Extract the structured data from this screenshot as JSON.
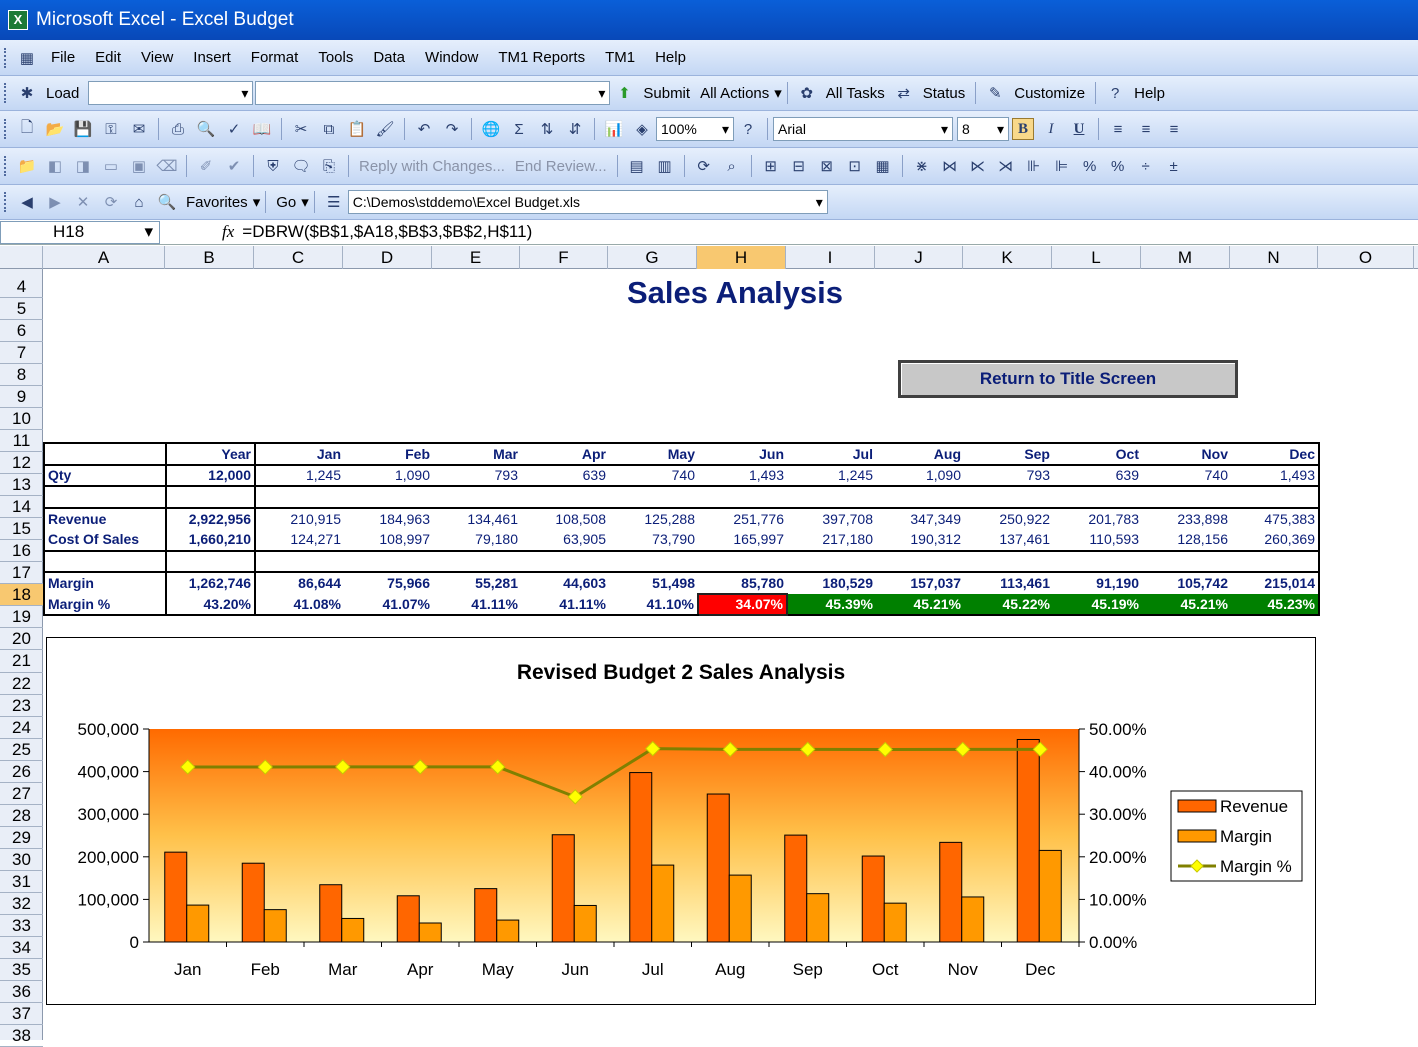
{
  "window": {
    "title": "Microsoft Excel - Excel Budget"
  },
  "menu": [
    "File",
    "Edit",
    "View",
    "Insert",
    "Format",
    "Tools",
    "Data",
    "Window",
    "TM1 Reports",
    "TM1",
    "Help"
  ],
  "tm1bar": {
    "load": "Load",
    "submit": "Submit",
    "all_actions": "All Actions",
    "all_tasks": "All Tasks",
    "status": "Status",
    "customize": "Customize",
    "help": "Help"
  },
  "standard": {
    "zoom": "100%",
    "font": "Arial",
    "size": "8"
  },
  "reviewing": {
    "reply": "Reply with Changes...",
    "end": "End Review..."
  },
  "web": {
    "favorites": "Favorites",
    "go": "Go",
    "address": "C:\\Demos\\stddemo\\Excel Budget.xls"
  },
  "formula": {
    "cell": "H18",
    "fx": "fx",
    "value": "=DBRW($B$1,$A18,$B$3,$B$2,H$11)"
  },
  "columns": [
    "A",
    "B",
    "C",
    "D",
    "E",
    "F",
    "G",
    "H",
    "I",
    "J",
    "K",
    "L",
    "M",
    "N",
    "O"
  ],
  "rows": [
    "4",
    "5",
    "6",
    "7",
    "8",
    "9",
    "10",
    "11",
    "12",
    "13",
    "14",
    "15",
    "16",
    "17",
    "18",
    "19",
    "20",
    "21",
    "22",
    "23",
    "24",
    "25",
    "26",
    "27",
    "28",
    "29",
    "30",
    "31",
    "32",
    "33",
    "34",
    "35",
    "36",
    "37",
    "38"
  ],
  "sheet": {
    "title": "Sales Analysis",
    "return_button": "Return to Title Screen",
    "headers": [
      "Year",
      "Jan",
      "Feb",
      "Mar",
      "Apr",
      "May",
      "Jun",
      "Jul",
      "Aug",
      "Sep",
      "Oct",
      "Nov",
      "Dec"
    ],
    "qty": {
      "label": "Qty",
      "values": [
        "12,000",
        "1,245",
        "1,090",
        "793",
        "639",
        "740",
        "1,493",
        "1,245",
        "1,090",
        "793",
        "639",
        "740",
        "1,493"
      ]
    },
    "revenue": {
      "label": "Revenue",
      "values": [
        "2,922,956",
        "210,915",
        "184,963",
        "134,461",
        "108,508",
        "125,288",
        "251,776",
        "397,708",
        "347,349",
        "250,922",
        "201,783",
        "233,898",
        "475,383"
      ]
    },
    "cost": {
      "label": "Cost Of Sales",
      "values": [
        "1,660,210",
        "124,271",
        "108,997",
        "79,180",
        "63,905",
        "73,790",
        "165,997",
        "217,180",
        "190,312",
        "137,461",
        "110,593",
        "128,156",
        "260,369"
      ]
    },
    "margin": {
      "label": "Margin",
      "values": [
        "1,262,746",
        "86,644",
        "75,966",
        "55,281",
        "44,603",
        "51,498",
        "85,780",
        "180,529",
        "157,037",
        "113,461",
        "91,190",
        "105,742",
        "215,014"
      ]
    },
    "margin_pct": {
      "label": "Margin %",
      "values": [
        "43.20%",
        "41.08%",
        "41.07%",
        "41.11%",
        "41.11%",
        "41.10%",
        "34.07%",
        "45.39%",
        "45.21%",
        "45.22%",
        "45.19%",
        "45.21%",
        "45.23%"
      ]
    }
  },
  "chart_data": {
    "type": "bar",
    "title": "Revised Budget 2 Sales Analysis",
    "categories": [
      "Jan",
      "Feb",
      "Mar",
      "Apr",
      "May",
      "Jun",
      "Jul",
      "Aug",
      "Sep",
      "Oct",
      "Nov",
      "Dec"
    ],
    "series": [
      {
        "name": "Revenue",
        "type": "bar",
        "axis": "left",
        "color": "#ff6600",
        "values": [
          210915,
          184963,
          134461,
          108508,
          125288,
          251776,
          397708,
          347349,
          250922,
          201783,
          233898,
          475383
        ]
      },
      {
        "name": "Margin",
        "type": "bar",
        "axis": "left",
        "color": "#ff9900",
        "values": [
          86644,
          75966,
          55281,
          44603,
          51498,
          85780,
          180529,
          157037,
          113461,
          91190,
          105742,
          215014
        ]
      },
      {
        "name": "Margin %",
        "type": "line",
        "axis": "right",
        "color": "#808000",
        "values": [
          41.08,
          41.07,
          41.11,
          41.11,
          41.1,
          34.07,
          45.39,
          45.21,
          45.22,
          45.19,
          45.21,
          45.23
        ]
      }
    ],
    "ylim": [
      0,
      500000
    ],
    "y2lim": [
      0,
      50
    ],
    "yticks": [
      "0",
      "100,000",
      "200,000",
      "300,000",
      "400,000",
      "500,000"
    ],
    "y2ticks": [
      "0.00%",
      "10.00%",
      "20.00%",
      "30.00%",
      "40.00%",
      "50.00%"
    ],
    "legend": "right"
  }
}
